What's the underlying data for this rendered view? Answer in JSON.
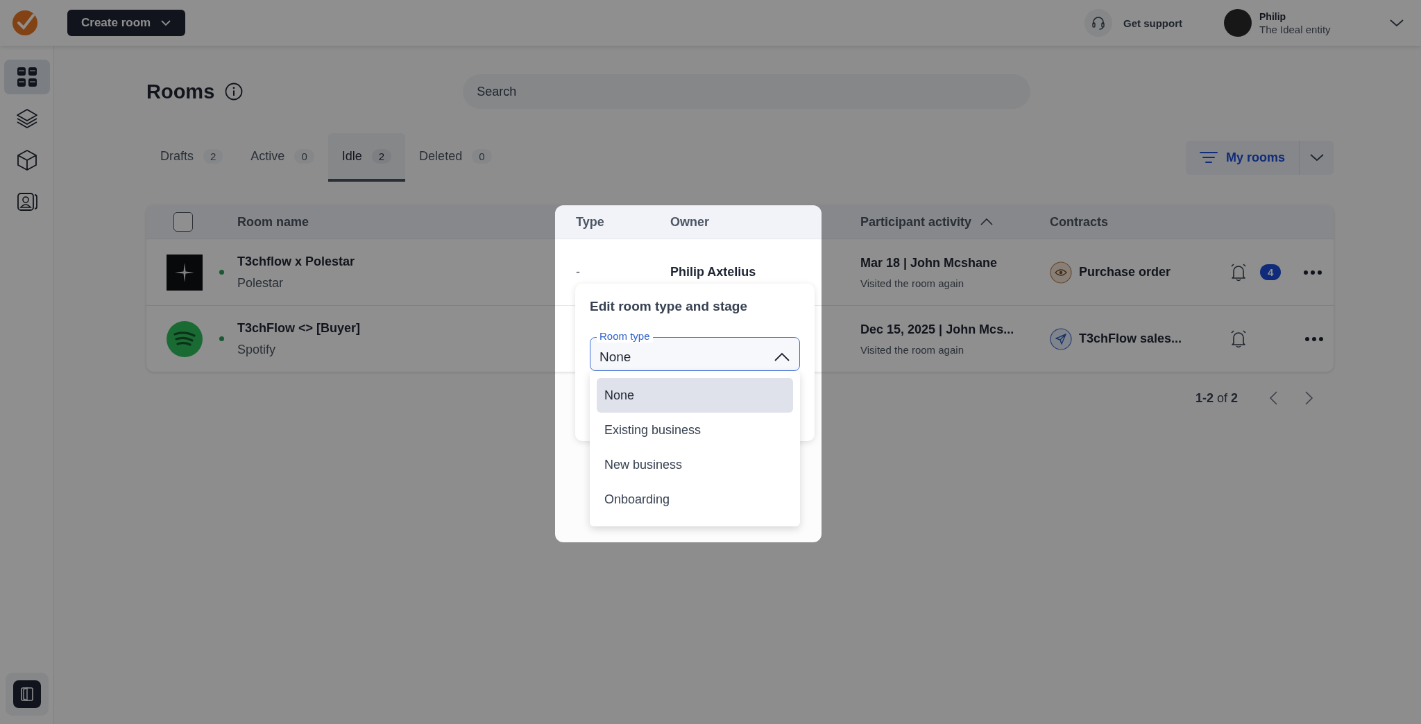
{
  "topbar": {
    "create_button": "Create room",
    "support": "Get support",
    "user": {
      "name": "Philip",
      "org": "The Ideal entity"
    }
  },
  "sidebar": {
    "items": [
      {
        "kind": "grid",
        "selected": true
      },
      {
        "kind": "layers",
        "selected": false
      },
      {
        "kind": "cube",
        "selected": false
      },
      {
        "kind": "contacts",
        "selected": false
      }
    ]
  },
  "page": {
    "title": "Rooms",
    "search": {
      "placeholder": "Search"
    }
  },
  "tabs": [
    {
      "label": "Drafts",
      "count": "2",
      "selected": false
    },
    {
      "label": "Active",
      "count": "0",
      "selected": false
    },
    {
      "label": "Idle",
      "count": "2",
      "selected": true
    },
    {
      "label": "Deleted",
      "count": "0",
      "selected": false
    }
  ],
  "filter": {
    "label": "My rooms"
  },
  "table": {
    "select_all_checked": false,
    "columns": [
      {
        "label": "Room name",
        "sorted": false
      },
      {
        "label": "Type",
        "sorted": false
      },
      {
        "label": "Owner",
        "sorted": false
      },
      {
        "label": "Participant activity",
        "sorted": true
      },
      {
        "label": "Contracts",
        "sorted": false
      }
    ],
    "rows": [
      {
        "kind": "star",
        "online": true,
        "name": "T3chflow x Polestar",
        "company": "Polestar",
        "type": "-",
        "owner": "Philip Axtelius",
        "activity": "Mar 18 | John Mcshane",
        "activity_sub": "Visited the room again",
        "contract": {
          "kind": "eye",
          "label": "Purchase order"
        },
        "alerts": "4"
      },
      {
        "kind": "waves",
        "online": true,
        "name": "T3chFlow <> [Buyer]",
        "company": "Spotify",
        "activity": "Dec 15, 2025 | John Mcs...",
        "activity_sub": "Visited the room again",
        "contract": {
          "kind": "send",
          "label": "T3chFlow sales..."
        }
      }
    ]
  },
  "pagination": {
    "text": "**1-2** of **2**"
  },
  "edit_card": {
    "title": "Edit room type and stage",
    "field": {
      "label": "Room type",
      "value": "None",
      "expanded": true
    },
    "options": [
      {
        "label": "None",
        "selected": true
      },
      {
        "label": "Existing business",
        "selected": false
      },
      {
        "label": "New business",
        "selected": false
      },
      {
        "label": "Onboarding",
        "selected": false
      }
    ]
  }
}
